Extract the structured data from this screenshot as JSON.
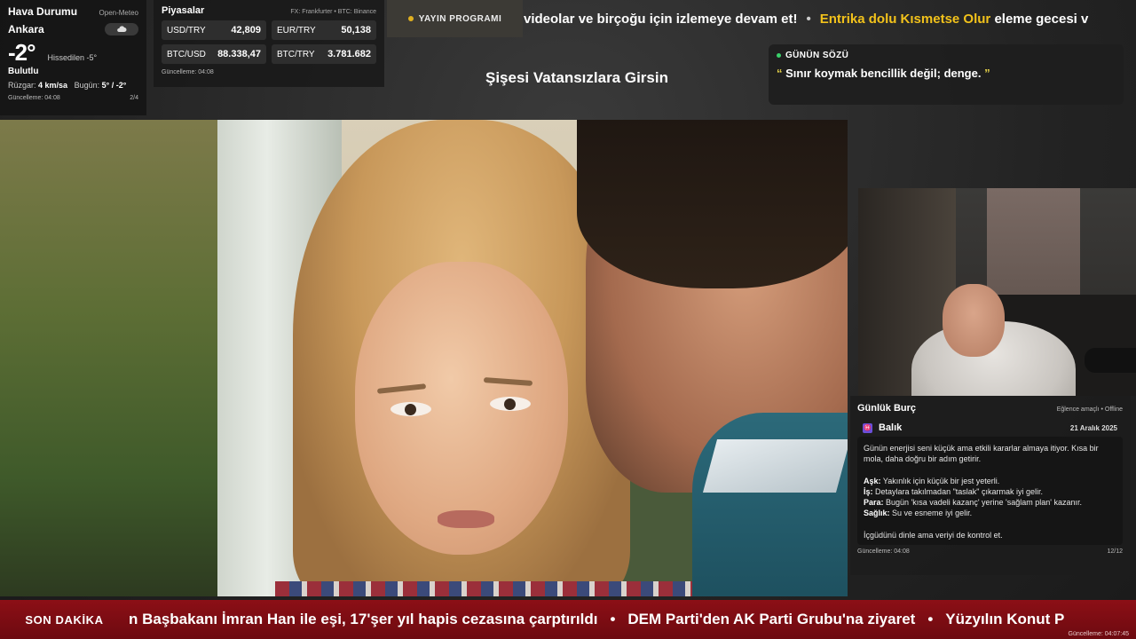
{
  "weather": {
    "title": "Hava Durumu",
    "source": "Open-Meteo",
    "city": "Ankara",
    "icon": "cloud-icon",
    "temperature": "-2°",
    "feels_like": "Hissedilen -5°",
    "condition": "Bulutlu",
    "wind_label": "Rüzgar:",
    "wind_value": "4 km/sa",
    "today_label": "Bugün:",
    "today_value": "5° / -2°",
    "updated": "Güncelleme: 04:08",
    "page": "2/4"
  },
  "markets": {
    "title": "Piyasalar",
    "source": "FX: Frankfurter • BTC: Binance",
    "items": [
      {
        "label": "USD/TRY",
        "value": "42,809"
      },
      {
        "label": "EUR/TRY",
        "value": "50,138"
      },
      {
        "label": "BTC/USD",
        "value": "88.338,47"
      },
      {
        "label": "BTC/TRY",
        "value": "3.781.682"
      }
    ],
    "updated": "Güncelleme: 04:08"
  },
  "schedule": {
    "label": "YAYIN PROGRAMI",
    "accent": "#e0b020"
  },
  "top_ticker": {
    "text1": "videolar ve birçoğu için izlemeye devam et!",
    "separator": "•",
    "highlight": "Entrika dolu Kısmetse Olur",
    "text2": "eleme gecesi v",
    "highlight_color": "#f2c21b"
  },
  "show_title": "Şişesi Vatansızlara Girsin",
  "quote": {
    "header": "GÜNÜN SÖZÜ",
    "open_mark": "“",
    "text": "Sınır koymak bencillik değil; denge.",
    "close_mark": "”"
  },
  "horoscope": {
    "title": "Günlük Burç",
    "source": "Eğlence amaçlı • Offline",
    "sign_badge": "♓",
    "sign": "Balık",
    "date": "21 Aralık 2025",
    "intro": "Günün enerjisi seni küçük ama etkili kararlar almaya itiyor. Kısa bir mola, daha doğru bir adım getirir.",
    "lines": [
      {
        "label": "Aşk:",
        "text": "Yakınlık için küçük bir jest yeterli."
      },
      {
        "label": "İş:",
        "text": "Detaylara takılmadan \"taslak\" çıkarmak iyi gelir."
      },
      {
        "label": "Para:",
        "text": "Bugün 'kısa vadeli kazanç' yerine 'sağlam plan' kazanır."
      },
      {
        "label": "Sağlık:",
        "text": "Su ve esneme iyi gelir."
      }
    ],
    "outro": "İçgüdünü dinle ama veriyi de kontrol et.",
    "updated": "Güncelleme: 04:08",
    "page": "12/12"
  },
  "news": {
    "label": "SON DAKİKA",
    "items": [
      "n Başbakanı İmran Han ile eşi, 17'şer yıl hapis cezasına çarptırıldı",
      "DEM Parti'den AK Parti Grubu'na ziyaret",
      "Yüzyılın Konut P"
    ],
    "separator": "•",
    "updated": "Güncelleme: 04:07:45",
    "color": "#8c0f16"
  }
}
